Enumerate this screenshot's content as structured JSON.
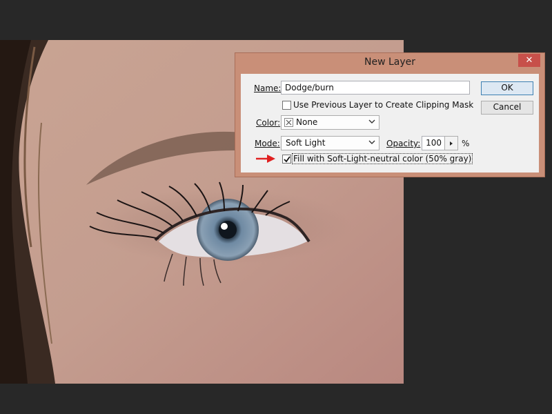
{
  "dialog": {
    "title": "New Layer",
    "close_glyph": "✕",
    "name_label": "Name:",
    "name_value": "Dodge/burn",
    "clip_label": "Use Previous Layer to Create Clipping Mask",
    "clip_checked": false,
    "color_label": "Color:",
    "color_value": "None",
    "mode_label": "Mode:",
    "mode_value": "Soft Light",
    "opacity_label": "Opacity:",
    "opacity_value": "100",
    "opacity_unit": "%",
    "fill_label": "Fill with Soft-Light-neutral color (50% gray)",
    "fill_checked": true,
    "ok_label": "OK",
    "cancel_label": "Cancel"
  },
  "colors": {
    "titlebar": "#c98f78",
    "close_button": "#c7504a",
    "arrow": "#e02020"
  },
  "icons": {
    "close": "close-icon",
    "none_color": "x-swatch-icon",
    "dropdown": "chevron-down-icon",
    "opacity_arrow": "triangle-right-icon",
    "check": "checkmark-icon",
    "annotation": "red-arrow-icon"
  }
}
